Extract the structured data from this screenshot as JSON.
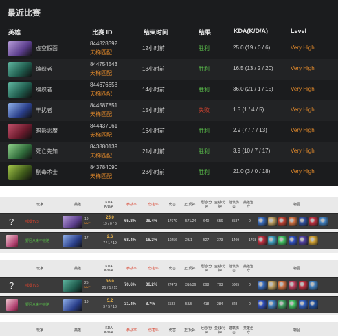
{
  "recent": {
    "title": "最近比赛",
    "columns": [
      "英雄",
      "比赛 ID",
      "结束时间",
      "结果",
      "KDA(K/D/A)",
      "Level"
    ],
    "matches": [
      {
        "hero": "虚空假面",
        "match_id": "844828392",
        "mode": "天梯匹配",
        "time": "12小时前",
        "result": "胜利",
        "win": true,
        "kda": "25.0 (19 / 0 / 6)",
        "level": "Very High",
        "icon": "faceless-void-portrait",
        "c1": "#5b3e8c",
        "c2": "#b59bd9"
      },
      {
        "hero": "编织者",
        "match_id": "844754543",
        "mode": "天梯匹配",
        "time": "13小时前",
        "result": "胜利",
        "win": true,
        "kda": "16.5 (13 / 2 / 20)",
        "level": "Very High",
        "icon": "weaver-portrait",
        "c1": "#1f5a4c",
        "c2": "#5fb6a0"
      },
      {
        "hero": "编织者",
        "match_id": "844676658",
        "mode": "天梯匹配",
        "time": "14小时前",
        "result": "胜利",
        "win": true,
        "kda": "36.0 (21 / 1 / 15)",
        "level": "Very High",
        "icon": "weaver-portrait",
        "c1": "#1f5a4c",
        "c2": "#5fb6a0"
      },
      {
        "hero": "干扰者",
        "match_id": "844587851",
        "mode": "天梯匹配",
        "time": "15小时前",
        "result": "失败",
        "win": false,
        "kda": "1.5 (1 / 4 / 5)",
        "level": "Very High",
        "icon": "disruptor-portrait",
        "c1": "#2a3f8a",
        "c2": "#8fb0ea"
      },
      {
        "hero": "暗影恶魔",
        "match_id": "844437061",
        "mode": "天梯匹配",
        "time": "16小时前",
        "result": "胜利",
        "win": true,
        "kda": "2.9 (7 / 7 / 13)",
        "level": "Very High",
        "icon": "shadow-demon-portrait",
        "c1": "#6a1a2c",
        "c2": "#c2506a"
      },
      {
        "hero": "死亡先知",
        "match_id": "843880139",
        "mode": "天梯匹配",
        "time": "21小时前",
        "result": "胜利",
        "win": true,
        "kda": "3.9 (10 / 7 / 17)",
        "level": "Very High",
        "icon": "death-prophet-portrait",
        "c1": "#2f6a3a",
        "c2": "#8fd08a"
      },
      {
        "hero": "剧毒术士",
        "match_id": "843784090",
        "mode": "天梯匹配",
        "time": "23小时前",
        "result": "胜利",
        "win": true,
        "kda": "21.0 (3 / 0 / 18)",
        "level": "Very High",
        "icon": "venomancer-portrait",
        "c1": "#3f5a1a",
        "c2": "#a6c84a"
      }
    ]
  },
  "scoreboard": {
    "header": {
      "player": "玩家",
      "hero": "英雄",
      "kda": "KDA\nK/D/A",
      "participation": "参战率",
      "damage_pct": "伤害%",
      "damage": "伤害",
      "lh_dn": "正/反补",
      "xpm": "经验/分\n钟",
      "gpm": "金钱/分\n钟",
      "building": "建筑伤\n害",
      "heal": "英雄治\n疗",
      "items": "物品"
    },
    "panels": [
      {
        "rows": [
          {
            "avatar": "?",
            "player": "嘿嘿TVS",
            "hero_icon": "faceless-void-portrait",
            "c1": "#5b3e8c",
            "c2": "#b59bd9",
            "level": "19",
            "level_sub": "MVP",
            "kda": "25.0",
            "kda_sub": "19 / 0 / 6",
            "participation": "65.8%",
            "damage_pct": "28.4%",
            "damage": "17679",
            "lh_dn": "571/24",
            "xpm": "640",
            "gpm": "656",
            "building": "3587",
            "heal": "0",
            "items": [
              "#3a6ec0",
              "#c0a060",
              "#c04030",
              "#d07040",
              "#3050a0",
              "#c03040",
              "#4080c0"
            ]
          },
          {
            "avatar": "img",
            "player": "野区从来不浪路",
            "hero_icon": "disruptor-portrait",
            "c1": "#2a3f8a",
            "c2": "#8fb0ea",
            "level": "17",
            "level_sub": "",
            "kda": "2.6",
            "kda_sub": "7 / 1 / 19",
            "participation": "68.4%",
            "damage_pct": "16.3%",
            "damage": "10256",
            "lh_dn": "23/1",
            "xpm": "527",
            "gpm": "373",
            "building": "1409",
            "heal": "1768",
            "items": [
              "#c03040",
              "#40a0c0",
              "#40c060",
              "#3050c0",
              "#5040a0",
              "#d0a030"
            ]
          }
        ]
      },
      {
        "rows": [
          {
            "avatar": "?",
            "player": "嘿嘿TVS",
            "hero_icon": "weaver-portrait",
            "c1": "#1f5a4c",
            "c2": "#5fb6a0",
            "level": "25",
            "level_sub": "MVP",
            "kda": "36.0",
            "kda_sub": "21 / 1 / 15",
            "participation": "70.6%",
            "damage_pct": "36.2%",
            "damage": "27472",
            "lh_dn": "310/36",
            "xpm": "898",
            "gpm": "793",
            "building": "5805",
            "heal": "0",
            "items": [
              "#3a6ec0",
              "#c0a060",
              "#d07040",
              "#c04060",
              "#c03040",
              "#4080c0"
            ]
          },
          {
            "avatar": "img",
            "player": "野区从来不浪路",
            "hero_icon": "disruptor-portrait",
            "c1": "#2a3f8a",
            "c2": "#8fb0ea",
            "level": "19",
            "level_sub": "",
            "kda": "5.2",
            "kda_sub": "3 / 5 / 13",
            "participation": "31.4%",
            "damage_pct": "8.7%",
            "damage": "6583",
            "lh_dn": "58/5",
            "xpm": "418",
            "gpm": "284",
            "building": "328",
            "heal": "0",
            "items": [
              "#3050c0",
              "#4080c0",
              "#40a060",
              "#40c060",
              "#3060c0",
              "#2050a0"
            ]
          }
        ]
      },
      {
        "rows": []
      }
    ]
  }
}
